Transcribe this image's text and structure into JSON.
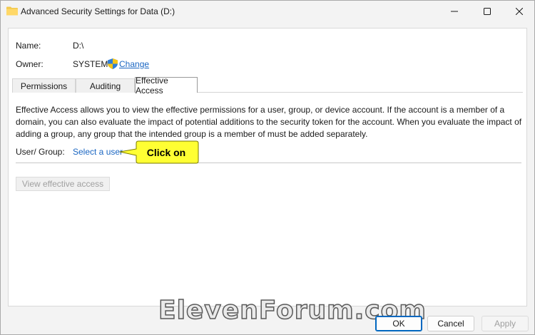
{
  "window": {
    "title": "Advanced Security Settings for Data (D:)",
    "icons": {
      "title": "folder-icon",
      "minimize": "minimize-icon",
      "maximize": "maximize-icon",
      "close": "close-icon"
    }
  },
  "details": {
    "name_label": "Name:",
    "name_value": "D:\\",
    "owner_label": "Owner:",
    "owner_value": "SYSTEM",
    "change_link": "Change",
    "change_icon": "uac-shield-icon"
  },
  "tabs": [
    {
      "label": "Permissions",
      "active": false
    },
    {
      "label": "Auditing",
      "active": false
    },
    {
      "label": "Effective Access",
      "active": true
    }
  ],
  "effective_access": {
    "description": "Effective Access allows you to view the effective permissions for a user, group, or device account. If the account is a member of a domain, you can also evaluate the impact of potential additions to the security token for the account. When you evaluate the impact of adding a group, any group that the intended group is a member of must be added separately.",
    "user_group_label": "User/ Group:",
    "select_user_link": "Select a user",
    "view_button": "View effective access"
  },
  "callout": {
    "text": "Click on",
    "color": "#ffff33"
  },
  "footer": {
    "ok": "OK",
    "cancel": "Cancel",
    "apply": "Apply"
  },
  "watermark": "ElevenForum.com",
  "colors": {
    "link": "#1a66c2",
    "accent": "#0067c0"
  }
}
